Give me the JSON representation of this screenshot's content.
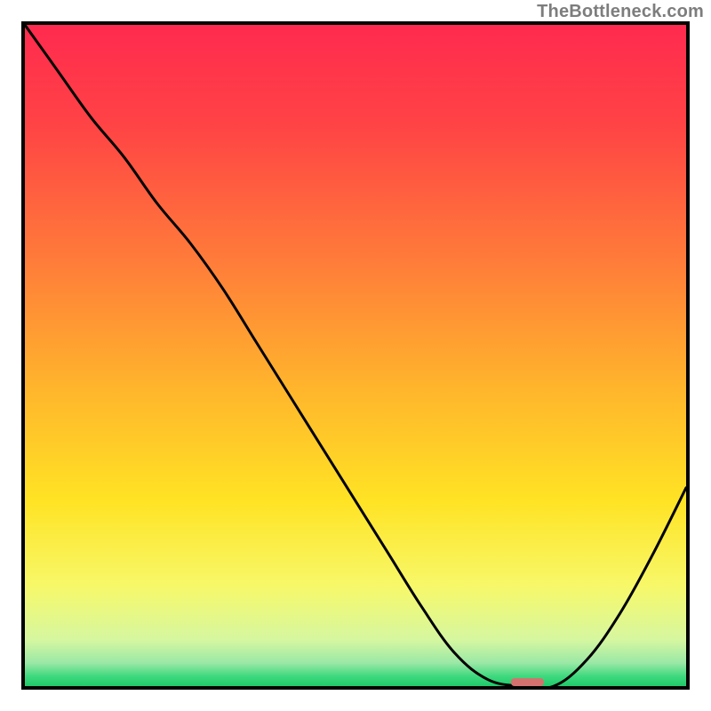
{
  "watermark": {
    "text": "TheBottleneck.com"
  },
  "chart_data": {
    "type": "line",
    "title": "",
    "xlabel": "",
    "ylabel": "",
    "xlim": [
      0,
      100
    ],
    "ylim": [
      0,
      100
    ],
    "x": [
      0,
      5,
      10,
      15,
      20,
      25,
      30,
      35,
      40,
      45,
      50,
      55,
      60,
      65,
      70,
      75,
      80,
      85,
      90,
      95,
      100
    ],
    "values": [
      100,
      93,
      86,
      80,
      73,
      67,
      60,
      52,
      44,
      36,
      28,
      20,
      12,
      5,
      1,
      0,
      0,
      4,
      11,
      20,
      30
    ],
    "gradient_stops": [
      {
        "pos": 0.0,
        "color": "#ff2a4f"
      },
      {
        "pos": 0.15,
        "color": "#ff4345"
      },
      {
        "pos": 0.35,
        "color": "#ff7a3a"
      },
      {
        "pos": 0.55,
        "color": "#ffb52c"
      },
      {
        "pos": 0.72,
        "color": "#ffe324"
      },
      {
        "pos": 0.85,
        "color": "#f7f86a"
      },
      {
        "pos": 0.93,
        "color": "#d6f7a0"
      },
      {
        "pos": 0.965,
        "color": "#9ae8a6"
      },
      {
        "pos": 0.985,
        "color": "#3fd97e"
      },
      {
        "pos": 1.0,
        "color": "#1fc96a"
      }
    ],
    "marker": {
      "x": 76,
      "y": 0,
      "width_frac": 0.05,
      "height_frac": 0.012,
      "color": "#d4716f"
    }
  }
}
